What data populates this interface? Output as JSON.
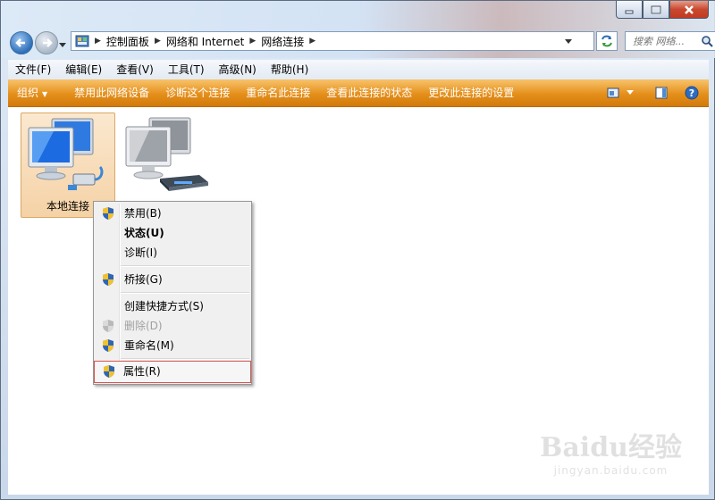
{
  "window": {
    "minimize": "–",
    "maximize": "□",
    "close": "✕"
  },
  "address": {
    "crumbs": [
      "控制面板",
      "网络和 Internet",
      "网络连接"
    ],
    "search_placeholder": "搜索 网络..."
  },
  "menubar": [
    "文件(F)",
    "编辑(E)",
    "查看(V)",
    "工具(T)",
    "高级(N)",
    "帮助(H)"
  ],
  "toolbar": {
    "organize": "组织",
    "items": [
      "禁用此网络设备",
      "诊断这个连接",
      "重命名此连接",
      "查看此连接的状态",
      "更改此连接的设置"
    ]
  },
  "items": [
    {
      "label": "本地连接",
      "selected": true
    },
    {
      "label": "",
      "selected": false
    }
  ],
  "context_menu": {
    "disable": "禁用(B)",
    "status": "状态(U)",
    "diagnose": "诊断(I)",
    "bridge": "桥接(G)",
    "shortcut": "创建快捷方式(S)",
    "delete": "删除(D)",
    "rename": "重命名(M)",
    "properties": "属性(R)"
  },
  "watermark": {
    "main": "Baidu经验",
    "sub": "jingyan.baidu.com"
  }
}
